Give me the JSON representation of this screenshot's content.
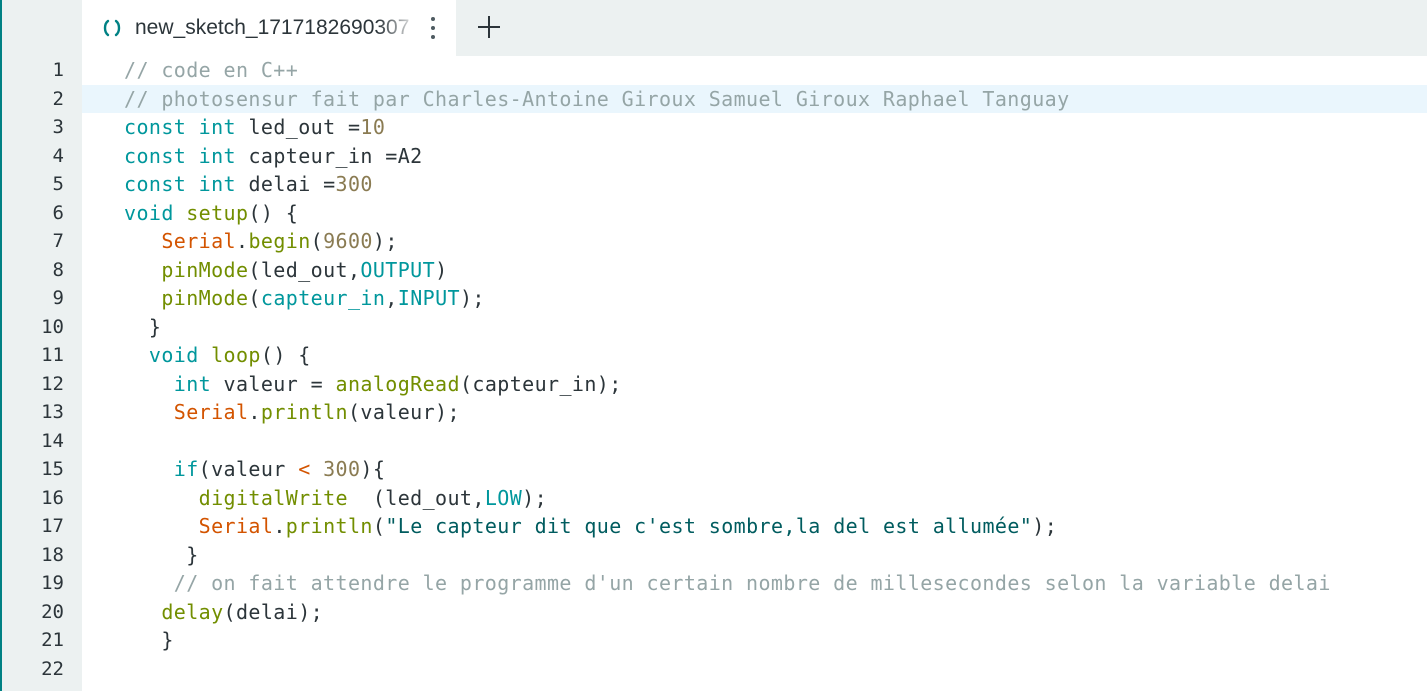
{
  "tab": {
    "title": "new_sketch_1717182690307",
    "icon": "sketch-file-icon",
    "menu_icon": "more-vertical-icon"
  },
  "add_tab_icon": "plus-icon",
  "colors": {
    "accent": "#008184",
    "gutter_bg": "#ecf1f1",
    "active_line_bg": "#eaf6fd",
    "comment": "#95a5a6",
    "keyword": "#00979c",
    "number": "#8a7b52",
    "object": "#d35400",
    "function": "#728e00",
    "string": "#005c5f",
    "text": "#2c353a"
  },
  "editor": {
    "active_line": 2,
    "lines": [
      {
        "number": "1",
        "tokens": [
          {
            "t": "comment",
            "v": "// code en C++"
          }
        ]
      },
      {
        "number": "2",
        "tokens": [
          {
            "t": "comment",
            "v": "// photosensur fait par Charles-Antoine Giroux Samuel Giroux Raphael Tanguay"
          }
        ]
      },
      {
        "number": "3",
        "tokens": [
          {
            "t": "keyword",
            "v": "const"
          },
          {
            "t": "plain",
            "v": " "
          },
          {
            "t": "keyword",
            "v": "int"
          },
          {
            "t": "plain",
            "v": " led_out ="
          },
          {
            "t": "number",
            "v": "10"
          }
        ]
      },
      {
        "number": "4",
        "tokens": [
          {
            "t": "keyword",
            "v": "const"
          },
          {
            "t": "plain",
            "v": " "
          },
          {
            "t": "keyword",
            "v": "int"
          },
          {
            "t": "plain",
            "v": " capteur_in =A2"
          }
        ]
      },
      {
        "number": "5",
        "tokens": [
          {
            "t": "keyword",
            "v": "const"
          },
          {
            "t": "plain",
            "v": " "
          },
          {
            "t": "keyword",
            "v": "int"
          },
          {
            "t": "plain",
            "v": " delai ="
          },
          {
            "t": "number",
            "v": "300"
          }
        ]
      },
      {
        "number": "6",
        "tokens": [
          {
            "t": "keyword",
            "v": "void"
          },
          {
            "t": "plain",
            "v": " "
          },
          {
            "t": "function",
            "v": "setup"
          },
          {
            "t": "plain",
            "v": "() {"
          }
        ]
      },
      {
        "number": "7",
        "tokens": [
          {
            "t": "plain",
            "v": "   "
          },
          {
            "t": "object",
            "v": "Serial"
          },
          {
            "t": "plain",
            "v": "."
          },
          {
            "t": "function",
            "v": "begin"
          },
          {
            "t": "plain",
            "v": "("
          },
          {
            "t": "number",
            "v": "9600"
          },
          {
            "t": "plain",
            "v": ");"
          }
        ]
      },
      {
        "number": "8",
        "tokens": [
          {
            "t": "plain",
            "v": "   "
          },
          {
            "t": "function",
            "v": "pinMode"
          },
          {
            "t": "plain",
            "v": "(led_out,"
          },
          {
            "t": "constant",
            "v": "OUTPUT"
          },
          {
            "t": "plain",
            "v": ")"
          }
        ]
      },
      {
        "number": "9",
        "tokens": [
          {
            "t": "plain",
            "v": "   "
          },
          {
            "t": "function",
            "v": "pinMode"
          },
          {
            "t": "plain",
            "v": "("
          },
          {
            "t": "keyword",
            "v": "capteur_in"
          },
          {
            "t": "plain",
            "v": ","
          },
          {
            "t": "constant",
            "v": "INPUT"
          },
          {
            "t": "plain",
            "v": ");"
          }
        ]
      },
      {
        "number": "10",
        "tokens": [
          {
            "t": "plain",
            "v": "  }"
          }
        ]
      },
      {
        "number": "11",
        "tokens": [
          {
            "t": "plain",
            "v": "  "
          },
          {
            "t": "keyword",
            "v": "void"
          },
          {
            "t": "plain",
            "v": " "
          },
          {
            "t": "function",
            "v": "loop"
          },
          {
            "t": "plain",
            "v": "() {"
          }
        ]
      },
      {
        "number": "12",
        "tokens": [
          {
            "t": "plain",
            "v": "    "
          },
          {
            "t": "keyword",
            "v": "int"
          },
          {
            "t": "plain",
            "v": " valeur = "
          },
          {
            "t": "function",
            "v": "analogRead"
          },
          {
            "t": "plain",
            "v": "(capteur_in);"
          }
        ]
      },
      {
        "number": "13",
        "tokens": [
          {
            "t": "plain",
            "v": "    "
          },
          {
            "t": "object",
            "v": "Serial"
          },
          {
            "t": "plain",
            "v": "."
          },
          {
            "t": "function",
            "v": "println"
          },
          {
            "t": "plain",
            "v": "(valeur);"
          }
        ]
      },
      {
        "number": "14",
        "tokens": []
      },
      {
        "number": "15",
        "tokens": [
          {
            "t": "plain",
            "v": "    "
          },
          {
            "t": "keyword",
            "v": "if"
          },
          {
            "t": "plain",
            "v": "(valeur "
          },
          {
            "t": "object",
            "v": "<"
          },
          {
            "t": "plain",
            "v": " "
          },
          {
            "t": "number",
            "v": "300"
          },
          {
            "t": "plain",
            "v": "){"
          }
        ]
      },
      {
        "number": "16",
        "tokens": [
          {
            "t": "plain",
            "v": "      "
          },
          {
            "t": "function",
            "v": "digitalWrite"
          },
          {
            "t": "plain",
            "v": "  (led_out,"
          },
          {
            "t": "constant",
            "v": "LOW"
          },
          {
            "t": "plain",
            "v": ");"
          }
        ]
      },
      {
        "number": "17",
        "tokens": [
          {
            "t": "plain",
            "v": "      "
          },
          {
            "t": "object",
            "v": "Serial"
          },
          {
            "t": "plain",
            "v": "."
          },
          {
            "t": "function",
            "v": "println"
          },
          {
            "t": "plain",
            "v": "("
          },
          {
            "t": "string",
            "v": "\"Le capteur dit que c'est sombre,la del est allumée\""
          },
          {
            "t": "plain",
            "v": ");"
          }
        ]
      },
      {
        "number": "18",
        "tokens": [
          {
            "t": "plain",
            "v": "     }"
          }
        ]
      },
      {
        "number": "19",
        "tokens": [
          {
            "t": "plain",
            "v": "    "
          },
          {
            "t": "comment",
            "v": "// on fait attendre le programme d'un certain nombre de millesecondes selon la variable delai"
          }
        ]
      },
      {
        "number": "20",
        "tokens": [
          {
            "t": "plain",
            "v": "   "
          },
          {
            "t": "function",
            "v": "delay"
          },
          {
            "t": "plain",
            "v": "(delai);"
          }
        ]
      },
      {
        "number": "21",
        "tokens": [
          {
            "t": "plain",
            "v": "   }"
          }
        ]
      },
      {
        "number": "22",
        "tokens": []
      }
    ]
  }
}
